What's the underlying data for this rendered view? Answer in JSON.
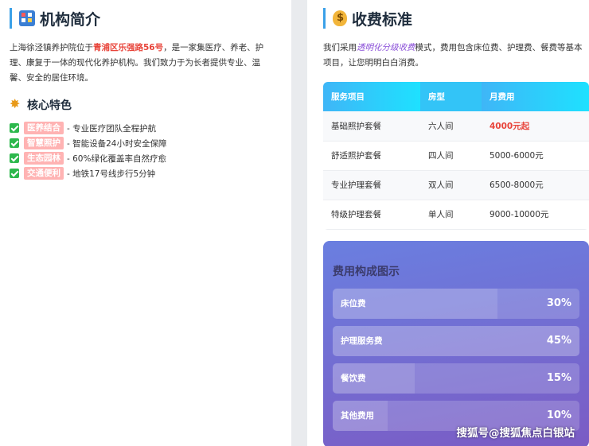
{
  "left": {
    "title": "机构简介",
    "title_icon": "building-icon",
    "intro_before": "上海徐泾镇养护院位于",
    "intro_highlight": "青浦区乐强路56号",
    "intro_after": "，是一家集医疗、养老、护理、康复于一体的现代化养护机构。我们致力于为长者提供专业、温馨、安全的居住环境。",
    "features_title": "核心特色",
    "features_icon": "sparkle-icon",
    "features": [
      {
        "tag": "医养结合",
        "text": " - 专业医疗团队全程护航"
      },
      {
        "tag": "智慧照护",
        "text": " - 智能设备24小时安全保障"
      },
      {
        "tag": "生态园林",
        "text": " - 60%绿化覆盖率自然疗愈"
      },
      {
        "tag": "交通便利",
        "text": " - 地铁17号线步行5分钟"
      }
    ]
  },
  "right": {
    "title": "收费标准",
    "title_icon": "money-bag-icon",
    "intro_before": "我们采用",
    "intro_highlight": "透明化分级收费",
    "intro_after": "模式，费用包含床位费、护理费、餐费等基本项目，让您明明白白消费。",
    "table": {
      "headers": [
        "服务项目",
        "房型",
        "月费用"
      ],
      "rows": [
        [
          "基础照护套餐",
          "六人间",
          "4000元起"
        ],
        [
          "舒适照护套餐",
          "四人间",
          "5000-6000元"
        ],
        [
          "专业护理套餐",
          "双人间",
          "6500-8000元"
        ],
        [
          "特级护理套餐",
          "单人间",
          "9000-10000元"
        ]
      ]
    }
  },
  "chart_data": {
    "type": "bar",
    "title": "费用构成图示",
    "categories": [
      "床位费",
      "护理服务费",
      "餐饮费",
      "其他费用"
    ],
    "values": [
      30,
      45,
      15,
      10
    ],
    "value_labels": [
      "30%",
      "45%",
      "15%",
      "10%"
    ]
  },
  "watermark": "搜狐号@搜狐焦点白银站",
  "colors": {
    "accent": "#3aa0e8",
    "highlight_red": "#e8443a",
    "highlight_purple": "#8a4fd8",
    "tag_bg": "#ffb3b3"
  }
}
